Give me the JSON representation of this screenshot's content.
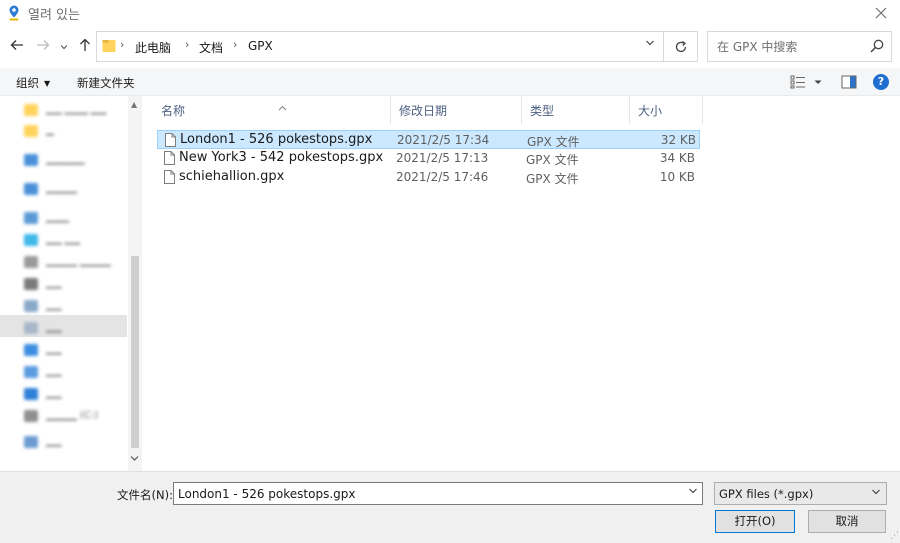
{
  "window": {
    "title": "열려 있는"
  },
  "address": {
    "crumbs": [
      "此电脑",
      "文档",
      "GPX"
    ],
    "search_placeholder": "在 GPX 中搜索"
  },
  "toolbar": {
    "organize": "组织",
    "new_folder": "新建文件夹"
  },
  "columns": {
    "name": "名称",
    "modified": "修改日期",
    "type": "类型",
    "size": "大小"
  },
  "files": [
    {
      "name": "London1 - 526 pokestops.gpx",
      "modified": "2021/2/5 17:34",
      "type": "GPX 文件",
      "size": "32 KB",
      "selected": true
    },
    {
      "name": "New York3 - 542 pokestops.gpx",
      "modified": "2021/2/5 17:13",
      "type": "GPX 文件",
      "size": "34 KB",
      "selected": false
    },
    {
      "name": "schiehallion.gpx",
      "modified": "2021/2/5 17:46",
      "type": "GPX 文件",
      "size": "10 KB",
      "selected": false
    }
  ],
  "bottom": {
    "filename_label": "文件名(N):",
    "filename_value": "London1 - 526 pokestops.gpx",
    "filter_value": "GPX files (*.gpx)",
    "open_label": "打开(O)",
    "cancel_label": "取消"
  },
  "colors": {
    "selection_fill": "#cce8ff",
    "selection_border": "#99d1ff",
    "accent": "#0078d7",
    "help_blue": "#1e6fd0",
    "folder_yellow": "#ffd35c"
  }
}
